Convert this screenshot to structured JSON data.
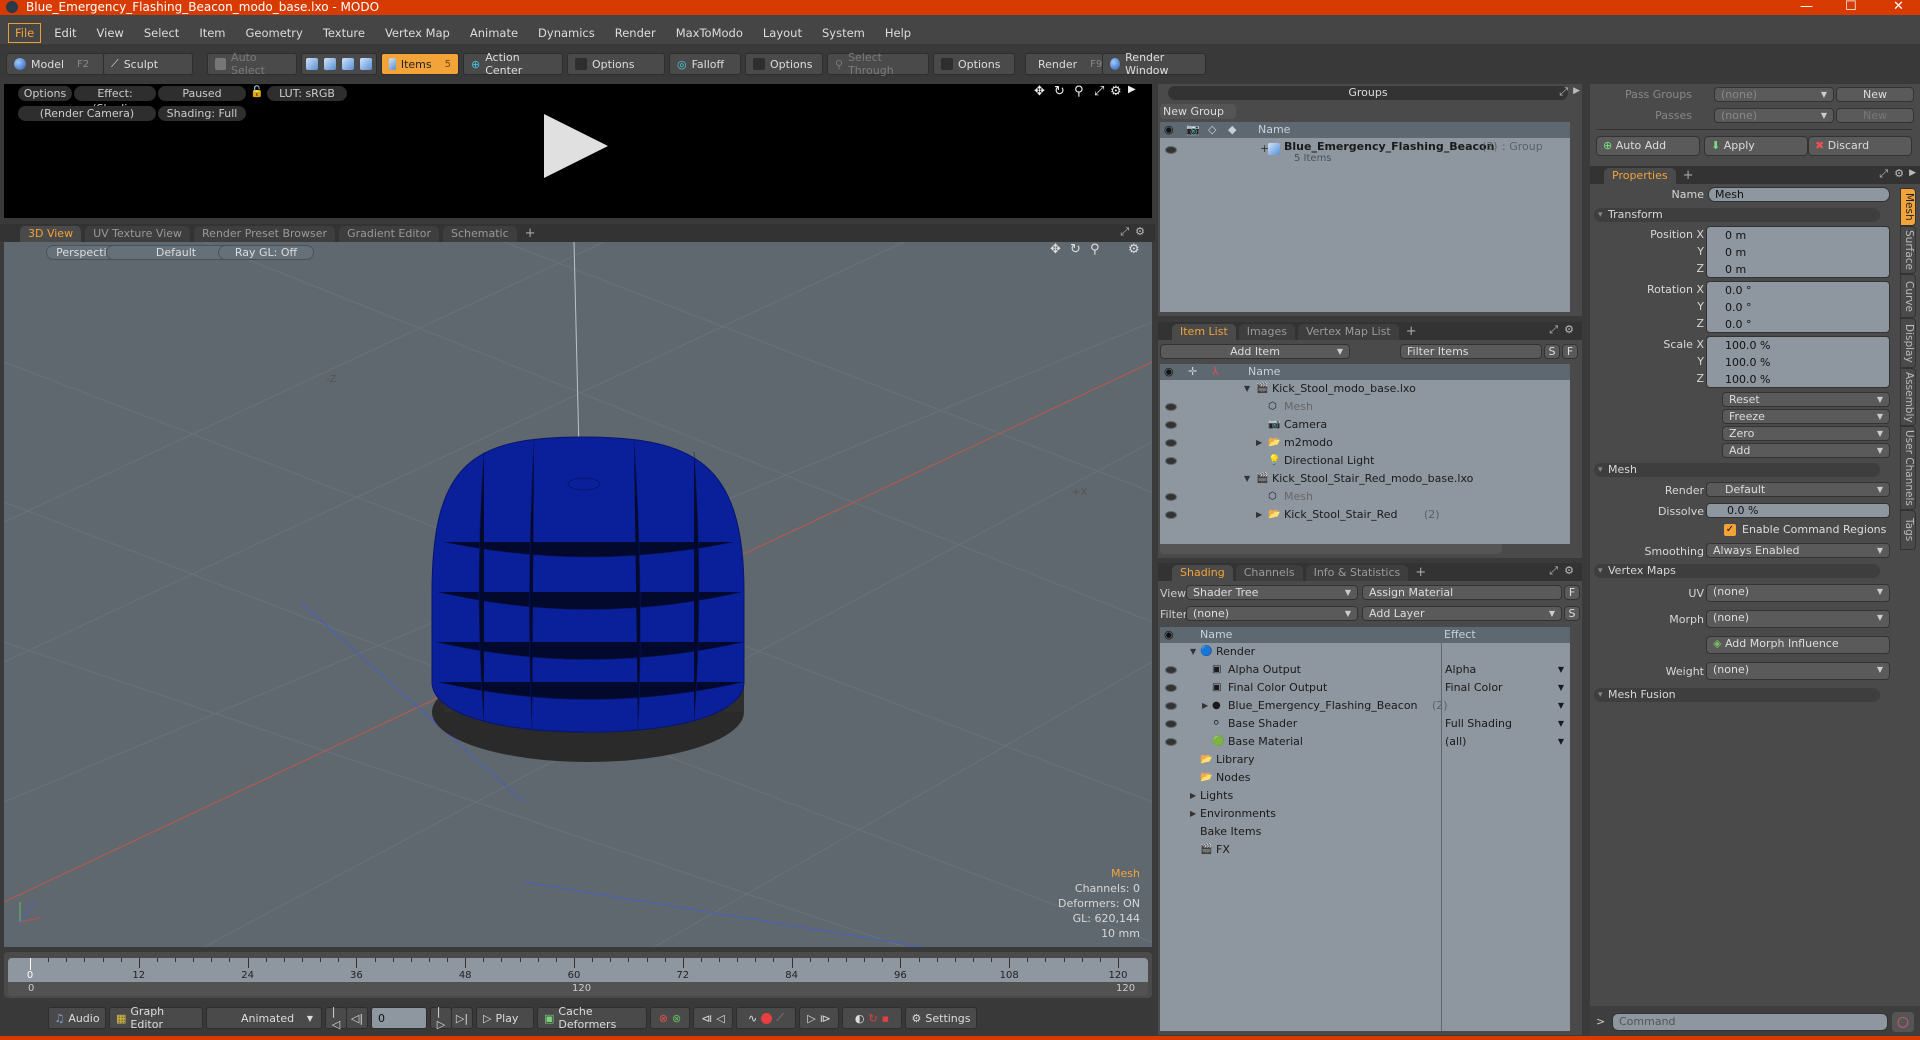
{
  "window": {
    "title": "Blue_Emergency_Flashing_Beacon_modo_base.lxo - MODO",
    "minimize": "—",
    "maximize": "☐",
    "close": "✕"
  },
  "menu": [
    "File",
    "Edit",
    "View",
    "Select",
    "Item",
    "Geometry",
    "Texture",
    "Vertex Map",
    "Animate",
    "Dynamics",
    "Render",
    "MaxToModo",
    "Layout",
    "System",
    "Help"
  ],
  "toolbar": {
    "model": "Model",
    "model_key": "F2",
    "sculpt": "Sculpt",
    "auto_select": "Auto Select",
    "items": "Items",
    "items_key": "5",
    "action_center": "Action Center",
    "options1": "Options",
    "falloff": "Falloff",
    "options2": "Options",
    "select_through": "Select Through",
    "options3": "Options",
    "render": "Render",
    "render_key": "F9",
    "render_window": "Render Window"
  },
  "preview": {
    "options": "Options",
    "effect": "Effect: (Shadi...",
    "paused": "Paused",
    "lut": "LUT: sRGB",
    "camera": "(Render Camera)",
    "shading": "Shading: Full"
  },
  "viewport_tabs": [
    "3D View",
    "UV Texture View",
    "Render Preset Browser",
    "Gradient Editor",
    "Schematic"
  ],
  "viewport": {
    "perspective": "Perspective",
    "default": "Default",
    "raygl": "Ray GL: Off",
    "axis_neg_z": "-Z",
    "axis_pos_x": "+X",
    "info": {
      "selection": "Mesh",
      "channels": "Channels: 0",
      "deformers": "Deformers: ON",
      "gl": "GL: 620,144",
      "scale": "10 mm"
    },
    "accent": "#f2a33a",
    "mesh_color": "#0a1f9a"
  },
  "timeline": {
    "ticks": [
      "0",
      "12",
      "24",
      "36",
      "48",
      "60",
      "72",
      "84",
      "96",
      "108",
      "120"
    ],
    "range_start": "0",
    "range_mid": "120",
    "range_end": "120"
  },
  "anim": {
    "audio": "Audio",
    "graph_editor": "Graph Editor",
    "mode": "Animated",
    "frame": "0",
    "play": "Play",
    "cache": "Cache Deformers",
    "settings": "Settings"
  },
  "groups": {
    "title": "Groups",
    "new_group": "New Group",
    "col_name": "Name",
    "row": {
      "name": "Blue_Emergency_Flashing_Beacon",
      "count": "(3)",
      "type": ": Group",
      "sub": "5 Items"
    }
  },
  "item_list": {
    "tabs": [
      "Item List",
      "Images",
      "Vertex Map List"
    ],
    "add_item": "Add Item",
    "filter": "Filter Items",
    "s": "S",
    "f": "F",
    "col_name": "Name",
    "rows": [
      {
        "name": "Kick_Stool_modo_base.lxo",
        "level": 0,
        "kind": "scene"
      },
      {
        "name": "Mesh",
        "level": 1,
        "kind": "mesh",
        "dim": true
      },
      {
        "name": "Camera",
        "level": 1,
        "kind": "camera"
      },
      {
        "name": "m2modo",
        "level": 1,
        "kind": "group"
      },
      {
        "name": "Directional Light",
        "level": 1,
        "kind": "light"
      },
      {
        "name": "Kick_Stool_Stair_Red_modo_base.lxo",
        "level": 0,
        "kind": "scene"
      },
      {
        "name": "Mesh",
        "level": 1,
        "kind": "mesh",
        "dim": true
      },
      {
        "name": "Kick_Stool_Stair_Red",
        "count": "(2)",
        "level": 1,
        "kind": "group"
      }
    ]
  },
  "shading": {
    "tabs": [
      "Shading",
      "Channels",
      "Info & Statistics"
    ],
    "view_label": "View",
    "view_value": "Shader Tree",
    "assign_material": "Assign Material",
    "filter_label": "Filter",
    "filter_value": "(none)",
    "add_layer": "Add Layer",
    "f": "F",
    "s": "S",
    "col_name": "Name",
    "col_effect": "Effect",
    "rows": [
      {
        "name": "Render",
        "effect": "",
        "level": 0,
        "icon": "render"
      },
      {
        "name": "Alpha Output",
        "effect": "Alpha",
        "level": 1,
        "icon": "output"
      },
      {
        "name": "Final Color Output",
        "effect": "Final Color",
        "level": 1,
        "icon": "output"
      },
      {
        "name": "Blue_Emergency_Flashing_Beacon",
        "count": "(2)",
        "effect": "",
        "level": 1,
        "icon": "mask"
      },
      {
        "name": "Base Shader",
        "effect": "Full Shading",
        "level": 1,
        "icon": "shader"
      },
      {
        "name": "Base Material",
        "effect": "(all)",
        "level": 1,
        "icon": "material"
      },
      {
        "name": "Library",
        "effect": "",
        "level": 0,
        "icon": "folder"
      },
      {
        "name": "Nodes",
        "effect": "",
        "level": 0,
        "icon": "folder"
      },
      {
        "name": "Lights",
        "effect": "",
        "level": 0,
        "icon": "none"
      },
      {
        "name": "Environments",
        "effect": "",
        "level": 0,
        "icon": "none"
      },
      {
        "name": "Bake Items",
        "effect": "",
        "level": 0,
        "icon": "none"
      },
      {
        "name": "FX",
        "effect": "",
        "level": 0,
        "icon": "fx"
      }
    ]
  },
  "passes": {
    "pass_groups": "Pass Groups",
    "passes": "Passes",
    "none": "(none)",
    "new": "New",
    "auto_add": "Auto Add",
    "apply": "Apply",
    "discard": "Discard"
  },
  "properties": {
    "tab": "Properties",
    "name_label": "Name",
    "name_value": "Mesh",
    "transform": "Transform",
    "position": {
      "label": "Position X",
      "x": "0 m",
      "y": "0 m",
      "z": "0 m"
    },
    "rotation": {
      "label": "Rotation X",
      "x": "0.0 °",
      "y": "0.0 °",
      "z": "0.0 °"
    },
    "scale": {
      "label": "Scale X",
      "x": "100.0 %",
      "y": "100.0 %",
      "z": "100.0 %"
    },
    "axis_y": "Y",
    "axis_z": "Z",
    "actions": [
      "Reset",
      "Freeze",
      "Zero",
      "Add"
    ],
    "mesh": "Mesh",
    "render_label": "Render",
    "render_value": "Default",
    "dissolve_label": "Dissolve",
    "dissolve_value": "0.0 %",
    "command_regions": "Enable Command Regions",
    "smoothing_label": "Smoothing",
    "smoothing_value": "Always Enabled",
    "vertex_maps": "Vertex Maps",
    "uv_label": "UV",
    "uv_value": "(none)",
    "morph_label": "Morph",
    "morph_value": "(none)",
    "add_morph": "Add Morph Influence",
    "weight_label": "Weight",
    "weight_value": "(none)",
    "mesh_fusion": "Mesh Fusion",
    "side_tabs": [
      "Mesh",
      "Surface",
      "Curve",
      "Display",
      "Assembly",
      "User Channels",
      "Tags"
    ]
  },
  "command": {
    "prompt": ">",
    "placeholder": "Command"
  }
}
